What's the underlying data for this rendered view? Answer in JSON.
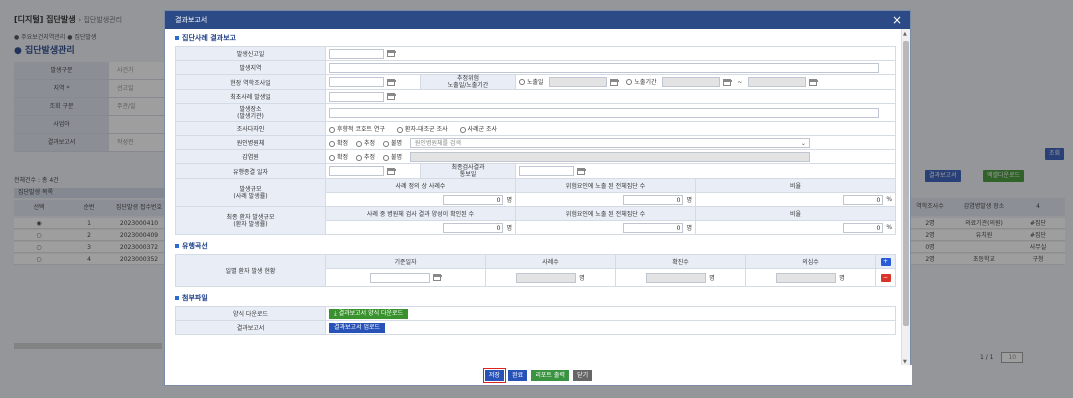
{
  "background": {
    "title": "[디지털] 집단발생",
    "title_sub": "› 집단발생관리",
    "breadcrumb": "● 주요보건지역관리 ● 집단발생",
    "heading": "집단발생관리",
    "form_rows": [
      {
        "label": "발생구분",
        "value": "사건가"
      },
      {
        "label": "지역 *",
        "value": "선고일"
      },
      {
        "label": "조회 구분",
        "value": "주관/일"
      },
      {
        "label": "사업아",
        "value": ""
      },
      {
        "label": "결과보고서",
        "value": "작성전"
      }
    ],
    "count_text": "전체건수 : 총 4건",
    "table_title": "집단발생 목록",
    "table_headers": [
      "선택",
      "순번",
      "집단발생 접수번호"
    ],
    "rows": [
      [
        "◉",
        "1",
        "2023000410"
      ],
      [
        "○",
        "2",
        "2023000409"
      ],
      [
        "○",
        "3",
        "2023000372"
      ],
      [
        "○",
        "4",
        "2023000352"
      ]
    ],
    "right_buttons": {
      "search": "조회",
      "report": "결과보고서",
      "excel": "엑셀다운로드"
    },
    "right_headers": [
      "역학조사수",
      "감염병발생 장소",
      "4"
    ],
    "right_rows": [
      [
        "2명",
        "의료기관(의원)",
        "#집단"
      ],
      [
        "2명",
        "유치원",
        "#집단"
      ],
      [
        "0명",
        "",
        "사무실"
      ],
      [
        "2명",
        "초등학교",
        "구청"
      ]
    ],
    "pager": {
      "page": "1 / 1",
      "size": "10"
    }
  },
  "modal": {
    "title": "결과보고서",
    "close_icon": "×",
    "section1": "집단사례 결과보고",
    "labels": {
      "report_date": "발생신고일",
      "region": "발생지역",
      "investigation": "현장 역학조사일",
      "exposure_period": "추정위험\n노출일/노출기간",
      "first_case": "최초사례 발생일",
      "place": "발생장소\n(발생기관)",
      "investigator": "조사다자인",
      "pathogen": "원인병원체",
      "infection": "감염원",
      "end_date": "유행종결 일자",
      "final_report": "최종검사결과\n통보일",
      "scale": "발생규모\n(사례 발생률)",
      "final_scale": "최종 환자 발생규모\n(환자 발생률)"
    },
    "exposure_options": {
      "a": "노출일",
      "b": "노출기간",
      "tilde": "~"
    },
    "investigator_options": [
      "후향적 코호트 연구",
      "환자-대조군 조사",
      "사례군 조사"
    ],
    "pathogen_options": [
      "확정",
      "추정",
      "불명"
    ],
    "pathogen_select": "원인병원체를 검색",
    "infection_options": [
      "확정",
      "추정",
      "불명"
    ],
    "scale_headers": [
      "사례 정의 상 사례수",
      "위험요인에 노출 된 전체집단 수",
      "비율"
    ],
    "final_headers": [
      "사례 중 병원체 검사 결과 양성이 확인된 수",
      "위험요인에 노출 된 전체집단 수",
      "비율"
    ],
    "scale_values": [
      "0",
      "0",
      "0"
    ],
    "final_values": [
      "0",
      "0",
      "0"
    ],
    "unit_person": "명",
    "unit_percent": "%",
    "section2": "유행곡선",
    "curve_label": "일별 환자 발생 현황",
    "curve_headers": [
      "기준일자",
      "사례수",
      "확진수",
      "의심수"
    ],
    "curve_units": [
      "명",
      "명",
      "명"
    ],
    "plus": "+",
    "minus": "−",
    "section3": "첨부파일",
    "attach_rows": [
      {
        "label": "양식 다운로드",
        "button": "결과보고서 양식 다운로드"
      },
      {
        "label": "결과보고서",
        "button": "결과보고서 업로드"
      }
    ],
    "footer": {
      "save": "저장",
      "done": "완료",
      "report": "리포트 출력",
      "close": "닫기"
    }
  }
}
